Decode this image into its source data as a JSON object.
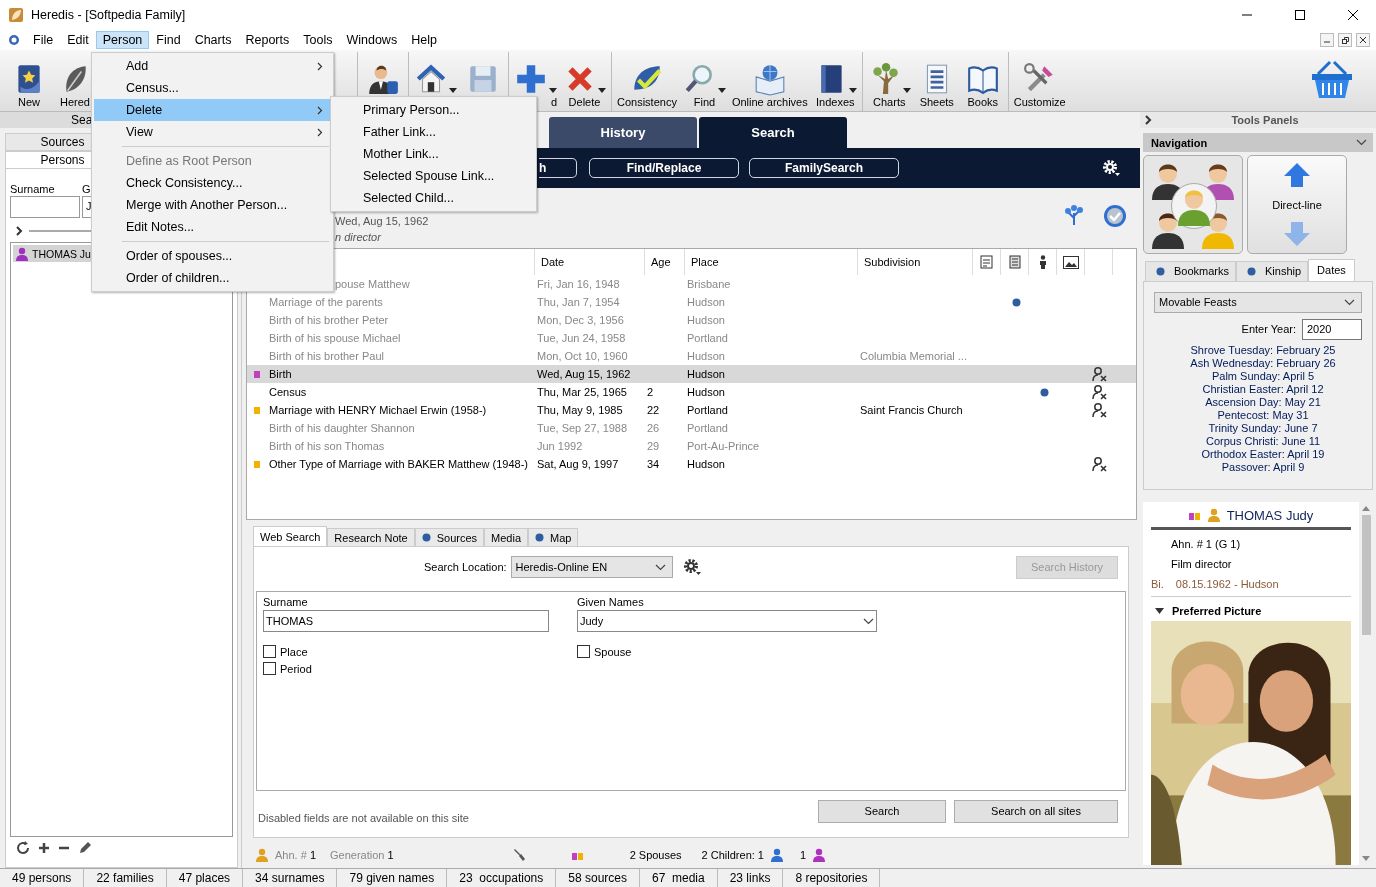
{
  "window": {
    "title": "Heredis - [Softpedia Family]"
  },
  "menu_bar": [
    {
      "label": "File",
      "selected": false
    },
    {
      "label": "Edit",
      "selected": false
    },
    {
      "label": "Person",
      "selected": true
    },
    {
      "label": "Find",
      "selected": false
    },
    {
      "label": "Charts",
      "selected": false
    },
    {
      "label": "Reports",
      "selected": false
    },
    {
      "label": "Tools",
      "selected": false
    },
    {
      "label": "Windows",
      "selected": false
    },
    {
      "label": "Help",
      "selected": false
    }
  ],
  "person_menu": [
    {
      "kind": "item",
      "label": "Add",
      "submenu": true,
      "selected": false,
      "disabled": false
    },
    {
      "kind": "item",
      "label": "Census...",
      "selected": false,
      "disabled": false
    },
    {
      "kind": "item",
      "label": "Delete",
      "submenu": true,
      "selected": true,
      "disabled": false
    },
    {
      "kind": "item",
      "label": "View",
      "submenu": true,
      "selected": false,
      "disabled": false
    },
    {
      "kind": "separator"
    },
    {
      "kind": "item",
      "label": "Define as Root Person",
      "selected": false,
      "disabled": true
    },
    {
      "kind": "item",
      "label": "Check Consistency...",
      "selected": false,
      "disabled": false
    },
    {
      "kind": "item",
      "label": "Merge with Another Person...",
      "selected": false,
      "disabled": false
    },
    {
      "kind": "item",
      "label": "Edit Notes...",
      "selected": false,
      "disabled": false
    },
    {
      "kind": "separator"
    },
    {
      "kind": "item",
      "label": "Order of spouses...",
      "selected": false,
      "disabled": false
    },
    {
      "kind": "item",
      "label": "Order of children...",
      "selected": false,
      "disabled": false
    }
  ],
  "delete_submenu": [
    "Primary Person...",
    "Father Link...",
    "Mother Link...",
    "Selected Spouse Link...",
    "Selected Child..."
  ],
  "toolbar": [
    [
      {
        "label": "New",
        "dropdown": false
      },
      {
        "label": "Hered",
        "dropdown": false
      }
    ],
    [
      {
        "dropdown": false
      }
    ],
    [
      {
        "dropdown": true
      },
      {
        "dropdown": false
      }
    ],
    [
      {
        "label": "d",
        "dropdown": true,
        "covered": true
      },
      {
        "label": "Delete",
        "dropdown": true
      }
    ],
    [
      {
        "label": "Consistency",
        "dropdown": false
      },
      {
        "label": "Find",
        "dropdown": true
      },
      {
        "label": "Online archives",
        "dropdown": false
      },
      {
        "label": "Indexes",
        "dropdown": true
      }
    ],
    [
      {
        "label": "Charts",
        "dropdown": true
      },
      {
        "label": "Sheets",
        "dropdown": false
      },
      {
        "label": "Books",
        "dropdown": false
      }
    ],
    [
      {
        "label": "Customize",
        "dropdown": false
      }
    ]
  ],
  "left_panel": {
    "header": "Sea",
    "tabs": [
      {
        "label": "Sources",
        "selected": false
      },
      {
        "label": "Persons",
        "selected": true
      }
    ],
    "surname_label": "Surname",
    "given_label": "G",
    "given_value": "J",
    "persons": [
      {
        "name": "THOMAS Ju",
        "selected": true
      }
    ]
  },
  "center": {
    "tabs": [
      {
        "label": "History",
        "selected": false
      },
      {
        "label": "Search",
        "selected": true
      }
    ],
    "tool_buttons": [
      "h",
      "Find/Replace",
      "FamilySearch"
    ],
    "person": {
      "date": "Wed, Aug 15, 1962",
      "occupation": "n director"
    },
    "table": {
      "columns": [
        "Date",
        "Age",
        "Place",
        "Subdivision"
      ],
      "rows": [
        {
          "event": "pouse Matthew",
          "date": "Fri, Jan 16, 1948",
          "place": "Brisbane",
          "primary": false,
          "selected": false,
          "covered": true
        },
        {
          "event": "Marriage of the parents",
          "date": "Thu, Jan 7, 1954",
          "place": "Hudson",
          "primary": false,
          "selected": false,
          "source_dot": true
        },
        {
          "event": "Birth of his brother Peter",
          "date": "Mon, Dec 3, 1956",
          "place": "Hudson",
          "primary": false,
          "selected": false
        },
        {
          "event": "Birth of his spouse Michael",
          "date": "Tue, Jun 24, 1958",
          "place": "Portland",
          "primary": false,
          "selected": false
        },
        {
          "event": "Birth of his brother Paul",
          "date": "Mon, Oct 10, 1960",
          "place": "Hudson",
          "subdivision": "Columbia Memorial ...",
          "primary": false,
          "selected": false
        },
        {
          "event": "Birth",
          "date": "Wed, Aug 15, 1962",
          "place": "Hudson",
          "primary": true,
          "selected": true,
          "color": "#c040c0",
          "flag": true
        },
        {
          "event": "Census",
          "date": "Thu, Mar 25, 1965",
          "age": "2",
          "place": "Hudson",
          "primary": true,
          "selected": false,
          "person_dot": true,
          "flag": true
        },
        {
          "event": "Marriage with HENRY Michael Erwin (1958-)",
          "date": "Thu, May 9, 1985",
          "age": "22",
          "place": "Portland",
          "subdivision": "Saint Francis Church",
          "primary": true,
          "selected": false,
          "color": "#f0b400",
          "flag": true
        },
        {
          "event": "Birth of his daughter Shannon",
          "date": "Tue, Sep 27, 1988",
          "age": "26",
          "place": "Portland",
          "primary": false,
          "selected": false
        },
        {
          "event": "Birth of his son Thomas",
          "date": "Jun 1992",
          "age": "29",
          "place": "Port-Au-Prince",
          "primary": false,
          "selected": false
        },
        {
          "event": "Other Type of Marriage with BAKER Matthew (1948-)",
          "date": "Sat, Aug 9, 1997",
          "age": "34",
          "place": "Hudson",
          "primary": true,
          "selected": false,
          "color": "#f0b400",
          "flag": true
        }
      ]
    },
    "lower_tabs": [
      {
        "label": "Web Search",
        "selected": true,
        "dot": false
      },
      {
        "label": "Research Note",
        "selected": false,
        "dot": false
      },
      {
        "label": "Sources",
        "selected": false,
        "dot": true
      },
      {
        "label": "Media",
        "selected": false,
        "dot": false
      },
      {
        "label": "Map",
        "selected": false,
        "dot": true
      }
    ],
    "search_location_label": "Search Location:",
    "search_location": "Heredis-Online EN",
    "search_history": {
      "label": "Search History",
      "disabled": true
    },
    "surname_label": "Surname",
    "surname": "THOMAS",
    "given_label": "Given Names",
    "given": "Judy",
    "left_checkboxes": [
      {
        "label": "Place",
        "checked": false
      },
      {
        "label": "Period",
        "checked": false
      }
    ],
    "right_checkboxes": [
      {
        "label": "Spouse",
        "checked": false
      }
    ],
    "note": "Disabled fields are not available on this site",
    "buttons": [
      "Search",
      "Search on all sites"
    ]
  },
  "info_bar": {
    "ahn_label": "Ahn. #",
    "ahn": "1",
    "generation_label": "Generation",
    "generation": "1",
    "spouses": "2 Spouses",
    "children": "2 Children: 1",
    "daughters": "1"
  },
  "right_panel": {
    "title": "Tools Panels",
    "navigation": "Navigation",
    "direct_line": "Direct-line",
    "tabs": [
      {
        "label": "Bookmarks",
        "selected": false,
        "dot": true
      },
      {
        "label": "Kinship",
        "selected": false,
        "dot": true
      },
      {
        "label": "Dates",
        "selected": true,
        "dot": false
      }
    ],
    "feast_type": "Movable Feasts",
    "year_label": "Enter Year:",
    "year": "2020",
    "feasts": [
      "Shrove Tuesday: February 25",
      "Ash Wednesday: February 26",
      "Palm Sunday: April 5",
      "Christian Easter: April 12",
      "Ascension Day: May 21",
      "Pentecost: May 31",
      "Trinity Sunday: June 7",
      "Corpus Christi: June 11",
      "Orthodox Easter: April 19",
      "Passover: April 9"
    ],
    "card": {
      "name": "THOMAS Judy",
      "ahn": "Ahn. # 1 (G 1)",
      "occupation": "Film director",
      "birth_label": "Bi.",
      "birth": "08.15.1962 - Hudson",
      "picture_label": "Preferred Picture"
    }
  },
  "status_bar": [
    "49 persons",
    "22 families",
    "47 places",
    "34 surnames",
    "79 given names",
    "23  occupations",
    "58 sources",
    "67  media",
    "23 links",
    "8 repositories"
  ]
}
